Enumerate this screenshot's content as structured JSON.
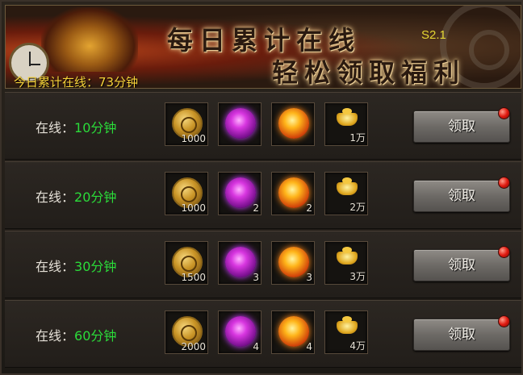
{
  "banner": {
    "title_line1": "每日累计在线",
    "title_line2": "轻松领取福利",
    "version": "S2.1",
    "today_online": "今日累计在线：73分钟"
  },
  "rows": [
    {
      "label_prefix": "在线：",
      "minutes": "10分钟",
      "rewards": {
        "coin": "1000",
        "purple_orb": "",
        "orange_orb": "",
        "ingot": "1万"
      },
      "claim_label": "领取"
    },
    {
      "label_prefix": "在线：",
      "minutes": "20分钟",
      "rewards": {
        "coin": "1000",
        "purple_orb": "2",
        "orange_orb": "2",
        "ingot": "2万"
      },
      "claim_label": "领取"
    },
    {
      "label_prefix": "在线：",
      "minutes": "30分钟",
      "rewards": {
        "coin": "1500",
        "purple_orb": "3",
        "orange_orb": "3",
        "ingot": "3万"
      },
      "claim_label": "领取"
    },
    {
      "label_prefix": "在线：",
      "minutes": "60分钟",
      "rewards": {
        "coin": "2000",
        "purple_orb": "4",
        "orange_orb": "4",
        "ingot": "4万"
      },
      "claim_label": "领取"
    }
  ],
  "icons": {
    "coin": "copper-coin-icon",
    "purple_orb": "purple-orb-icon",
    "orange_orb": "orange-orb-icon",
    "ingot": "gold-ingot-icon",
    "claim_badge": "red-notification-dot"
  },
  "colors": {
    "minutes_green": "#2bdc3a",
    "today_yellow": "#f7d33a",
    "version_yellow": "#e5d632",
    "badge_red": "#e01a10"
  }
}
